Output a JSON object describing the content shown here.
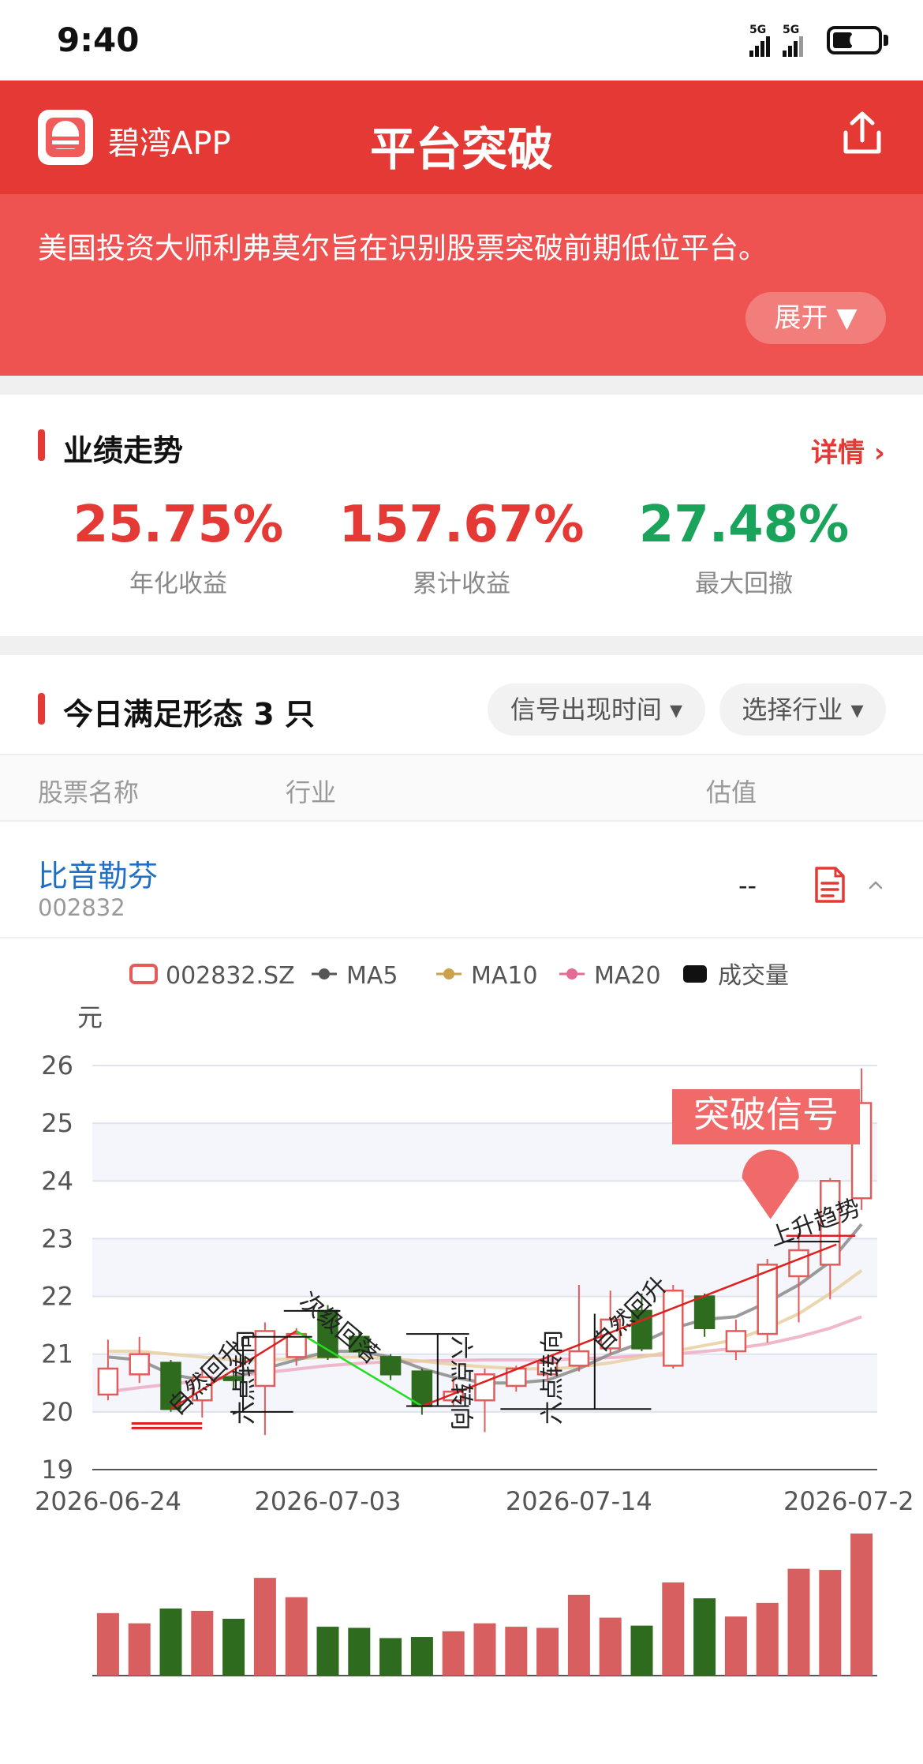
{
  "status_bar": {
    "time": "9:40",
    "signal_1": "5G",
    "signal_2": "5G",
    "battery": "6"
  },
  "header": {
    "app_name": "碧湾APP",
    "title": "平台突破",
    "share_icon": "share-icon"
  },
  "description": {
    "text": "美国投资大师利弗莫尔旨在识别股票突破前期低位平台。",
    "expand_label": "展开 ▼"
  },
  "performance": {
    "title": "业绩走势",
    "details_label": "详情 ›",
    "metrics": [
      {
        "value": "25.75%",
        "label": "年化收益",
        "color": "#e53935"
      },
      {
        "value": "157.67%",
        "label": "累计收益",
        "color": "#e53935"
      },
      {
        "value": "27.48%",
        "label": "最大回撤",
        "color": "#1aa35b"
      }
    ]
  },
  "today": {
    "title": "今日满足形态 3 只",
    "filter_time_label": "信号出现时间 ▾",
    "filter_industry_label": "选择行业 ▾",
    "columns": [
      "股票名称",
      "行业",
      "估值"
    ],
    "rows": [
      {
        "name": "比音勒芬",
        "code": "002832",
        "industry": "",
        "valuation": "--"
      }
    ]
  },
  "chart_data": {
    "type": "candlestick",
    "legend": [
      {
        "name": "002832.SZ",
        "color": "#e35b5b"
      },
      {
        "name": "MA5",
        "color": "#555555"
      },
      {
        "name": "MA10",
        "color": "#c9a24a"
      },
      {
        "name": "MA20",
        "color": "#e56a95"
      },
      {
        "name": "成交量",
        "color": "#111111"
      }
    ],
    "y_unit": "元",
    "ylim": [
      19,
      26
    ],
    "y_ticks": [
      "19",
      "20",
      "21",
      "22",
      "23",
      "24",
      "25",
      "26"
    ],
    "x_tick_labels": [
      "2026-06-24",
      "2026-07-03",
      "2026-07-14",
      "2026-07-2"
    ],
    "candles": [
      {
        "o": 20.3,
        "c": 20.75,
        "h": 21.25,
        "l": 20.2
      },
      {
        "o": 20.65,
        "c": 21.0,
        "h": 21.3,
        "l": 20.5
      },
      {
        "o": 20.85,
        "c": 20.05,
        "h": 20.9,
        "l": 20.0
      },
      {
        "o": 20.2,
        "c": 20.6,
        "h": 20.8,
        "l": 19.9
      },
      {
        "o": 20.6,
        "c": 20.55,
        "h": 20.7,
        "l": 20.4
      },
      {
        "o": 20.45,
        "c": 21.4,
        "h": 21.55,
        "l": 19.6
      },
      {
        "o": 20.95,
        "c": 21.35,
        "h": 21.45,
        "l": 20.8
      },
      {
        "o": 21.75,
        "c": 20.95,
        "h": 21.85,
        "l": 20.9
      },
      {
        "o": 21.3,
        "c": 21.05,
        "h": 21.4,
        "l": 20.95
      },
      {
        "o": 20.95,
        "c": 20.65,
        "h": 21.0,
        "l": 20.55
      },
      {
        "o": 20.7,
        "c": 20.1,
        "h": 20.75,
        "l": 19.95
      },
      {
        "o": 20.2,
        "c": 20.35,
        "h": 20.6,
        "l": 20.1
      },
      {
        "o": 20.2,
        "c": 20.65,
        "h": 20.75,
        "l": 19.65
      },
      {
        "o": 20.45,
        "c": 20.75,
        "h": 20.8,
        "l": 20.35
      },
      {
        "o": 20.65,
        "c": 20.85,
        "h": 20.95,
        "l": 20.55
      },
      {
        "o": 20.8,
        "c": 21.05,
        "h": 22.2,
        "l": 20.7
      },
      {
        "o": 21.1,
        "c": 21.6,
        "h": 22.1,
        "l": 21.0
      },
      {
        "o": 21.75,
        "c": 21.1,
        "h": 22.05,
        "l": 21.05
      },
      {
        "o": 20.8,
        "c": 22.1,
        "h": 22.2,
        "l": 20.75
      },
      {
        "o": 22.0,
        "c": 21.45,
        "h": 22.05,
        "l": 21.3
      },
      {
        "o": 21.05,
        "c": 21.4,
        "h": 21.6,
        "l": 20.9
      },
      {
        "o": 21.35,
        "c": 22.55,
        "h": 22.65,
        "l": 21.2
      },
      {
        "o": 22.35,
        "c": 22.8,
        "h": 23.1,
        "l": 21.55
      },
      {
        "o": 22.55,
        "c": 24.0,
        "h": 24.05,
        "l": 21.95
      },
      {
        "o": 23.7,
        "c": 25.35,
        "h": 25.95,
        "l": 23.5
      }
    ],
    "ma5": [
      20.95,
      20.9,
      20.65,
      20.55,
      20.6,
      20.75,
      20.9,
      21.05,
      21.05,
      20.95,
      20.75,
      20.6,
      20.5,
      20.5,
      20.55,
      20.75,
      21.0,
      21.2,
      21.45,
      21.6,
      21.65,
      21.9,
      22.2,
      22.6,
      23.25
    ],
    "ma10": [
      21.05,
      21.05,
      21.0,
      20.95,
      20.9,
      20.9,
      20.92,
      20.95,
      20.95,
      20.92,
      20.88,
      20.82,
      20.78,
      20.75,
      20.74,
      20.78,
      20.85,
      20.95,
      21.05,
      21.15,
      21.25,
      21.45,
      21.7,
      22.05,
      22.45
    ],
    "ma20": [
      20.35,
      20.42,
      20.48,
      20.55,
      20.62,
      20.68,
      20.74,
      20.8,
      20.84,
      20.87,
      20.88,
      20.89,
      20.9,
      20.9,
      20.9,
      20.92,
      20.94,
      20.97,
      21.0,
      21.05,
      21.1,
      21.18,
      21.3,
      21.45,
      21.65
    ],
    "volume": [
      55,
      46,
      59,
      57,
      50,
      86,
      69,
      43,
      42,
      33,
      34,
      39,
      46,
      43,
      42,
      71,
      51,
      44,
      82,
      68,
      52,
      64,
      94,
      93,
      125
    ],
    "annotations": [
      "自然回升",
      "次级回落",
      "六点转向",
      "六点转向",
      "六点转向",
      "自然回升",
      "上升趋势"
    ],
    "signal_label": "突破信号"
  }
}
